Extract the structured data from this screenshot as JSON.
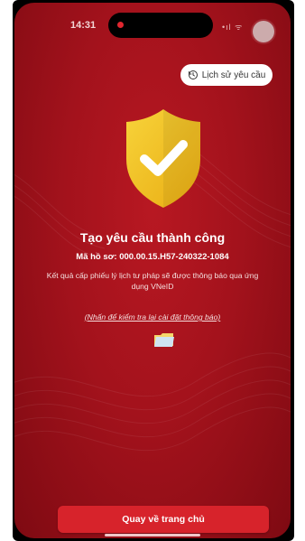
{
  "status_bar": {
    "time": "14:31",
    "icons": "•ıl ᯤ"
  },
  "header": {
    "history_button_label": "Lịch sử yêu cầu"
  },
  "result": {
    "title": "Tạo yêu cầu thành công",
    "record_number": "Mã hồ sơ: 000.00.15.H57-240322-1084",
    "notification_note": "Kết quả cấp phiếu lý lịch tư pháp sẽ được thông báo qua ứng dụng VNeID",
    "check_settings_link": "(Nhấn để kiểm tra lại cài đặt thông báo)"
  },
  "footer": {
    "home_button_label": "Quay về trang chủ"
  },
  "colors": {
    "background": "#a3121c",
    "button": "#d7232b",
    "shield": "#f2c11d",
    "island_dot": "#e0262f"
  },
  "icons": [
    "history-icon",
    "shield-check-icon",
    "folder-icon"
  ]
}
